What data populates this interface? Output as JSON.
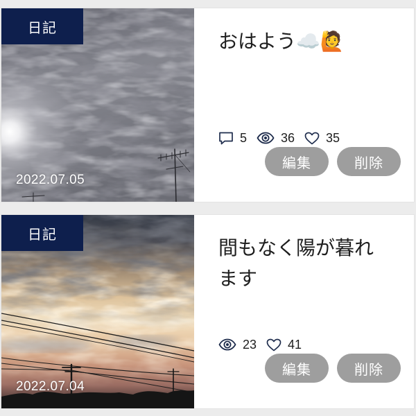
{
  "posts": [
    {
      "category": "日記",
      "date": "2022.07.05",
      "title": "おはよう☁️🙋",
      "stats": [
        {
          "icon": "comment-icon",
          "value": 5
        },
        {
          "icon": "eye-icon",
          "value": 36
        },
        {
          "icon": "heart-icon",
          "value": 35
        }
      ],
      "actions": {
        "edit": "編集",
        "delete": "削除"
      }
    },
    {
      "category": "日記",
      "date": "2022.07.04",
      "title": "間もなく陽が暮れます",
      "stats": [
        {
          "icon": "eye-icon",
          "value": 23
        },
        {
          "icon": "heart-icon",
          "value": 41
        }
      ],
      "actions": {
        "edit": "編集",
        "delete": "削除"
      }
    }
  ],
  "colors": {
    "badge": "#0e1f4d",
    "button": "#9e9e9e",
    "icon": "#1f2d4d",
    "background": "#ececec",
    "text": "#1e1e1e"
  }
}
